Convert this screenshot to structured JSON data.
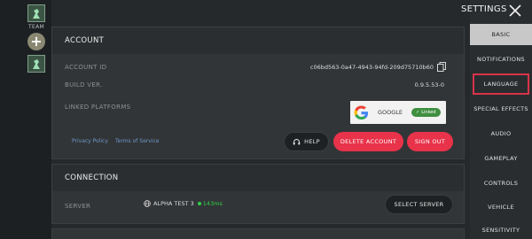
{
  "team_rail": {
    "team_label": "TEAM"
  },
  "header": {
    "title": "SETTINGS"
  },
  "sidebar": {
    "items": [
      {
        "label": "BASIC"
      },
      {
        "label": "NOTIFICATIONS"
      },
      {
        "label": "LANGUAGE"
      },
      {
        "label": "SPECIAL EFFECTS"
      },
      {
        "label": "AUDIO"
      },
      {
        "label": "GAMEPLAY"
      },
      {
        "label": "CONTROLS"
      },
      {
        "label": "VEHICLE"
      },
      {
        "label": "SENSITIVITY"
      }
    ],
    "selected": "BASIC"
  },
  "account": {
    "title": "ACCOUNT",
    "account_id_label": "ACCOUNT ID",
    "account_id_value": "c06bd563-0a47-4943-94fd-209d75710b60",
    "build_label": "BUILD VER.",
    "build_value": "0.9.5.53-0",
    "linked_label": "LINKED PLATFORMS",
    "linked_platform": "GOOGLE",
    "linked_status": "Linked",
    "privacy_link": "Privacy Policy",
    "terms_link": "Terms of Service",
    "help_label": "HELP",
    "delete_label": "DELETE ACCOUNT",
    "signout_label": "SIGN OUT"
  },
  "connection": {
    "title": "CONNECTION",
    "server_label": "SERVER",
    "server_name": "ALPHA TEST 3",
    "ping": "143ms",
    "select_label": "SELECT SERVER"
  },
  "colors": {
    "accent_red": "#e8334a",
    "linked_green": "#3f8f3f",
    "ping_green": "#2fcf4a",
    "link_blue": "#6d97c9"
  }
}
